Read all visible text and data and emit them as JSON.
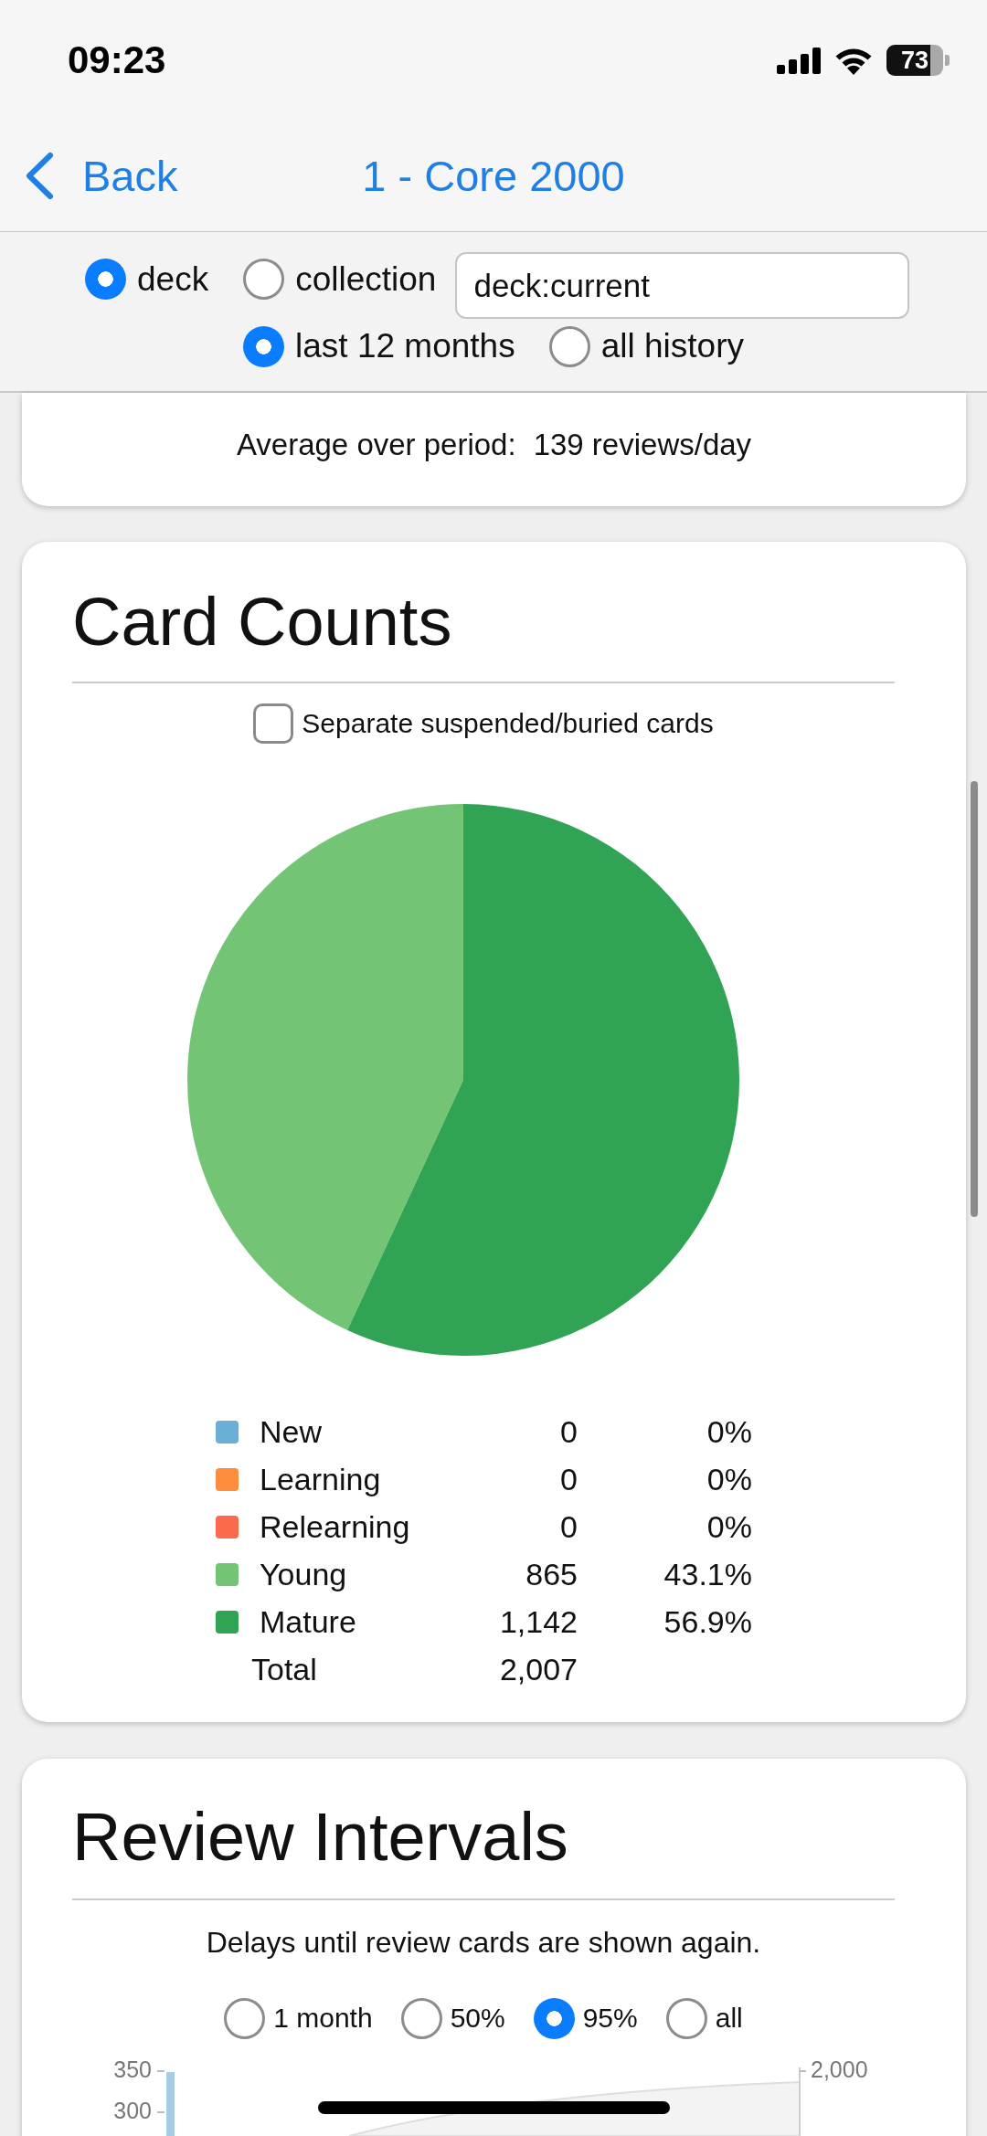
{
  "status_bar": {
    "time": "09:23",
    "battery": "73"
  },
  "nav": {
    "back": "Back",
    "title": "1 - Core 2000"
  },
  "filter": {
    "scope_options": [
      {
        "label": "deck",
        "selected": true
      },
      {
        "label": "collection",
        "selected": false
      }
    ],
    "search": {
      "value": "deck:current"
    },
    "period_options": [
      {
        "label": "last 12 months",
        "selected": true
      },
      {
        "label": "all history",
        "selected": false
      }
    ]
  },
  "review_summary": {
    "label": "Average over period:",
    "value": "139 reviews/day"
  },
  "card_counts": {
    "title": "Card Counts",
    "separate_checkbox": {
      "label": "Separate suspended/buried cards",
      "checked": false
    },
    "chart_data": {
      "type": "pie",
      "categories": [
        "New",
        "Learning",
        "Relearning",
        "Young",
        "Mature"
      ],
      "values": [
        0,
        0,
        0,
        43.1,
        56.9
      ]
    },
    "legend": [
      {
        "count": "0",
        "percent": "0%",
        "color": "#6baed6"
      },
      {
        "count": "0",
        "percent": "0%",
        "color": "#fd8d3c"
      },
      {
        "count": "0",
        "percent": "0%",
        "color": "#fb6a4a"
      },
      {
        "count": "865",
        "percent": "43.1%",
        "color": "#74c476"
      },
      {
        "count": "1,142",
        "percent": "56.9%",
        "color": "#31a354"
      }
    ],
    "total": {
      "label": "Total",
      "count": "2,007"
    }
  },
  "review_intervals": {
    "title": "Review Intervals",
    "subtitle": "Delays until review cards are shown again.",
    "range_options": [
      {
        "label": "1 month",
        "selected": false
      },
      {
        "label": "50%",
        "selected": false
      },
      {
        "label": "95%",
        "selected": true
      },
      {
        "label": "all",
        "selected": false
      }
    ],
    "chart": {
      "left_ticks": [
        "350",
        "300"
      ],
      "right_ticks": [
        "2,000"
      ]
    }
  }
}
